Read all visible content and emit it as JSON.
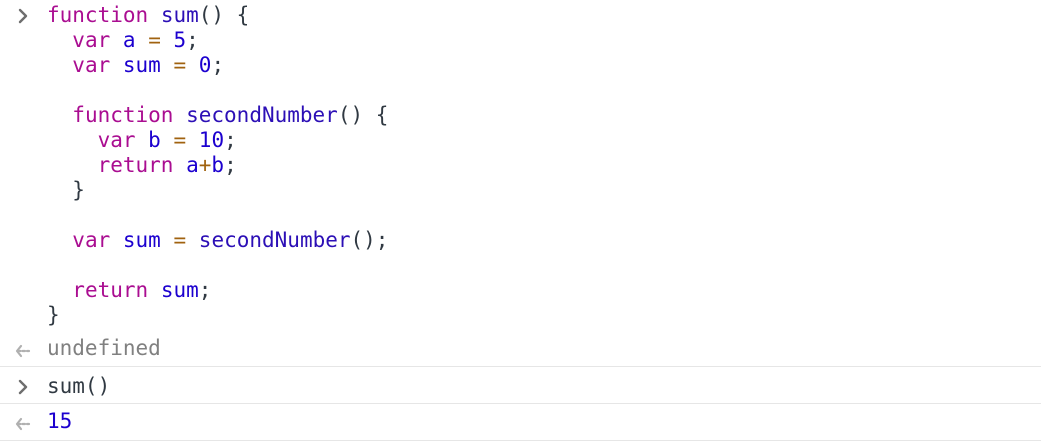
{
  "input1": {
    "lines": [
      [
        {
          "t": "function",
          "c": "kw"
        },
        {
          "t": " ",
          "c": "plain"
        },
        {
          "t": "sum",
          "c": "fn"
        },
        {
          "t": "() {",
          "c": "punct"
        }
      ],
      [
        {
          "t": "  ",
          "c": "plain"
        },
        {
          "t": "var",
          "c": "kw"
        },
        {
          "t": " ",
          "c": "plain"
        },
        {
          "t": "a",
          "c": "var"
        },
        {
          "t": " ",
          "c": "plain"
        },
        {
          "t": "=",
          "c": "op"
        },
        {
          "t": " ",
          "c": "plain"
        },
        {
          "t": "5",
          "c": "num"
        },
        {
          "t": ";",
          "c": "punct"
        }
      ],
      [
        {
          "t": "  ",
          "c": "plain"
        },
        {
          "t": "var",
          "c": "kw"
        },
        {
          "t": " ",
          "c": "plain"
        },
        {
          "t": "sum",
          "c": "var"
        },
        {
          "t": " ",
          "c": "plain"
        },
        {
          "t": "=",
          "c": "op"
        },
        {
          "t": " ",
          "c": "plain"
        },
        {
          "t": "0",
          "c": "num"
        },
        {
          "t": ";",
          "c": "punct"
        }
      ],
      [],
      [
        {
          "t": "  ",
          "c": "plain"
        },
        {
          "t": "function",
          "c": "kw"
        },
        {
          "t": " ",
          "c": "plain"
        },
        {
          "t": "secondNumber",
          "c": "fn"
        },
        {
          "t": "() {",
          "c": "punct"
        }
      ],
      [
        {
          "t": "    ",
          "c": "plain"
        },
        {
          "t": "var",
          "c": "kw"
        },
        {
          "t": " ",
          "c": "plain"
        },
        {
          "t": "b",
          "c": "var"
        },
        {
          "t": " ",
          "c": "plain"
        },
        {
          "t": "=",
          "c": "op"
        },
        {
          "t": " ",
          "c": "plain"
        },
        {
          "t": "10",
          "c": "num"
        },
        {
          "t": ";",
          "c": "punct"
        }
      ],
      [
        {
          "t": "    ",
          "c": "plain"
        },
        {
          "t": "return",
          "c": "kw"
        },
        {
          "t": " ",
          "c": "plain"
        },
        {
          "t": "a",
          "c": "var"
        },
        {
          "t": "+",
          "c": "op"
        },
        {
          "t": "b",
          "c": "var"
        },
        {
          "t": ";",
          "c": "punct"
        }
      ],
      [
        {
          "t": "  }",
          "c": "punct"
        }
      ],
      [],
      [
        {
          "t": "  ",
          "c": "plain"
        },
        {
          "t": "var",
          "c": "kw"
        },
        {
          "t": " ",
          "c": "plain"
        },
        {
          "t": "sum",
          "c": "var"
        },
        {
          "t": " ",
          "c": "plain"
        },
        {
          "t": "=",
          "c": "op"
        },
        {
          "t": " ",
          "c": "plain"
        },
        {
          "t": "secondNumber",
          "c": "fn"
        },
        {
          "t": "();",
          "c": "punct"
        }
      ],
      [],
      [
        {
          "t": "  ",
          "c": "plain"
        },
        {
          "t": "return",
          "c": "kw"
        },
        {
          "t": " ",
          "c": "plain"
        },
        {
          "t": "sum",
          "c": "var"
        },
        {
          "t": ";",
          "c": "punct"
        }
      ],
      [
        {
          "t": "}",
          "c": "punct"
        }
      ]
    ]
  },
  "output1": {
    "text": "undefined"
  },
  "input2": {
    "text": "sum()"
  },
  "output2": {
    "text": "15"
  },
  "icons": {
    "input": "chevron-right-icon",
    "output": "return-arrow-icon"
  },
  "colors": {
    "keyword": "#aa0d91",
    "function_name": "#2c0fb6",
    "variable": "#1c00cf",
    "number": "#1c00cf",
    "operator": "#a0620f",
    "undefined": "#808080",
    "border": "#e6e6e6"
  }
}
